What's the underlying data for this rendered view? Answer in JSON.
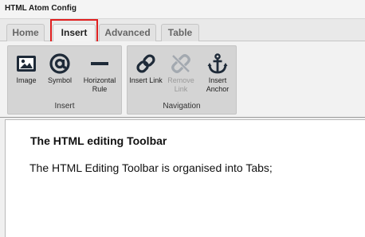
{
  "window": {
    "title": "HTML Atom Config"
  },
  "tabs": [
    {
      "label": "Home"
    },
    {
      "label": "Insert"
    },
    {
      "label": "Advanced"
    },
    {
      "label": "Table"
    }
  ],
  "ribbon": {
    "groups": [
      {
        "label": "Insert",
        "buttons": [
          {
            "label": "Image",
            "icon": "image-icon"
          },
          {
            "label": "Symbol",
            "icon": "at-symbol-icon"
          },
          {
            "label": "Horizontal Rule",
            "icon": "horizontal-rule-icon"
          }
        ]
      },
      {
        "label": "Navigation",
        "buttons": [
          {
            "label": "Insert Link",
            "icon": "link-icon"
          },
          {
            "label": "Remove Link",
            "icon": "unlink-icon",
            "disabled": true
          },
          {
            "label": "Insert Anchor",
            "icon": "anchor-icon"
          }
        ]
      }
    ]
  },
  "editor": {
    "heading": "The HTML editing Toolbar",
    "paragraph": "The HTML Editing Toolbar is organised into Tabs;"
  },
  "colors": {
    "highlight": "#e02020",
    "disabled_text": "#9a9a9a"
  }
}
